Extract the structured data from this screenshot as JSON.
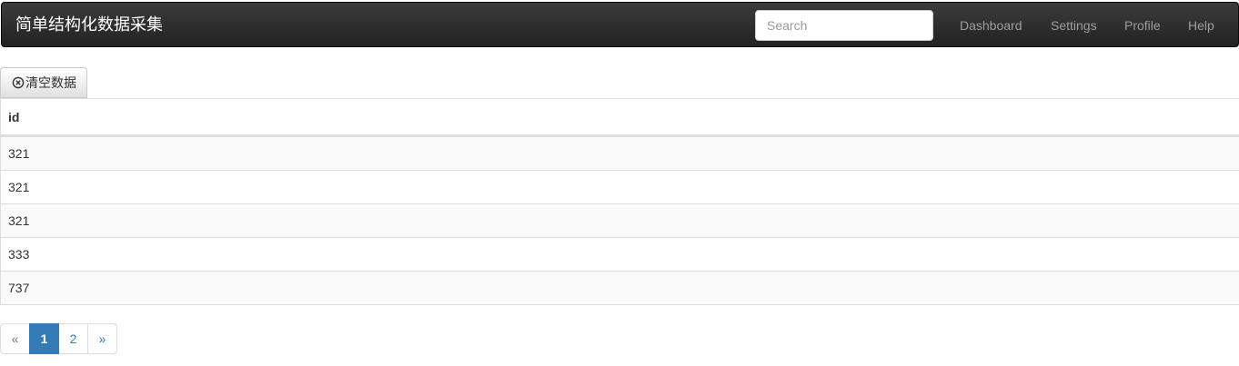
{
  "navbar": {
    "brand": "简单结构化数据采集",
    "search_placeholder": "Search",
    "links": [
      "Dashboard",
      "Settings",
      "Profile",
      "Help"
    ]
  },
  "toolbar": {
    "clear_label": "清空数据",
    "clear_icon": "circle-x-icon"
  },
  "table": {
    "columns": [
      "id"
    ],
    "rows": [
      "321",
      "321",
      "321",
      "333",
      "737"
    ]
  },
  "pagination": {
    "prev_label": "«",
    "pages": [
      "1",
      "2"
    ],
    "active_page": "1",
    "next_label": "»"
  },
  "colors": {
    "navbar_bg": "#222222",
    "accent": "#337ab7",
    "stripe": "#f9f9f9"
  }
}
